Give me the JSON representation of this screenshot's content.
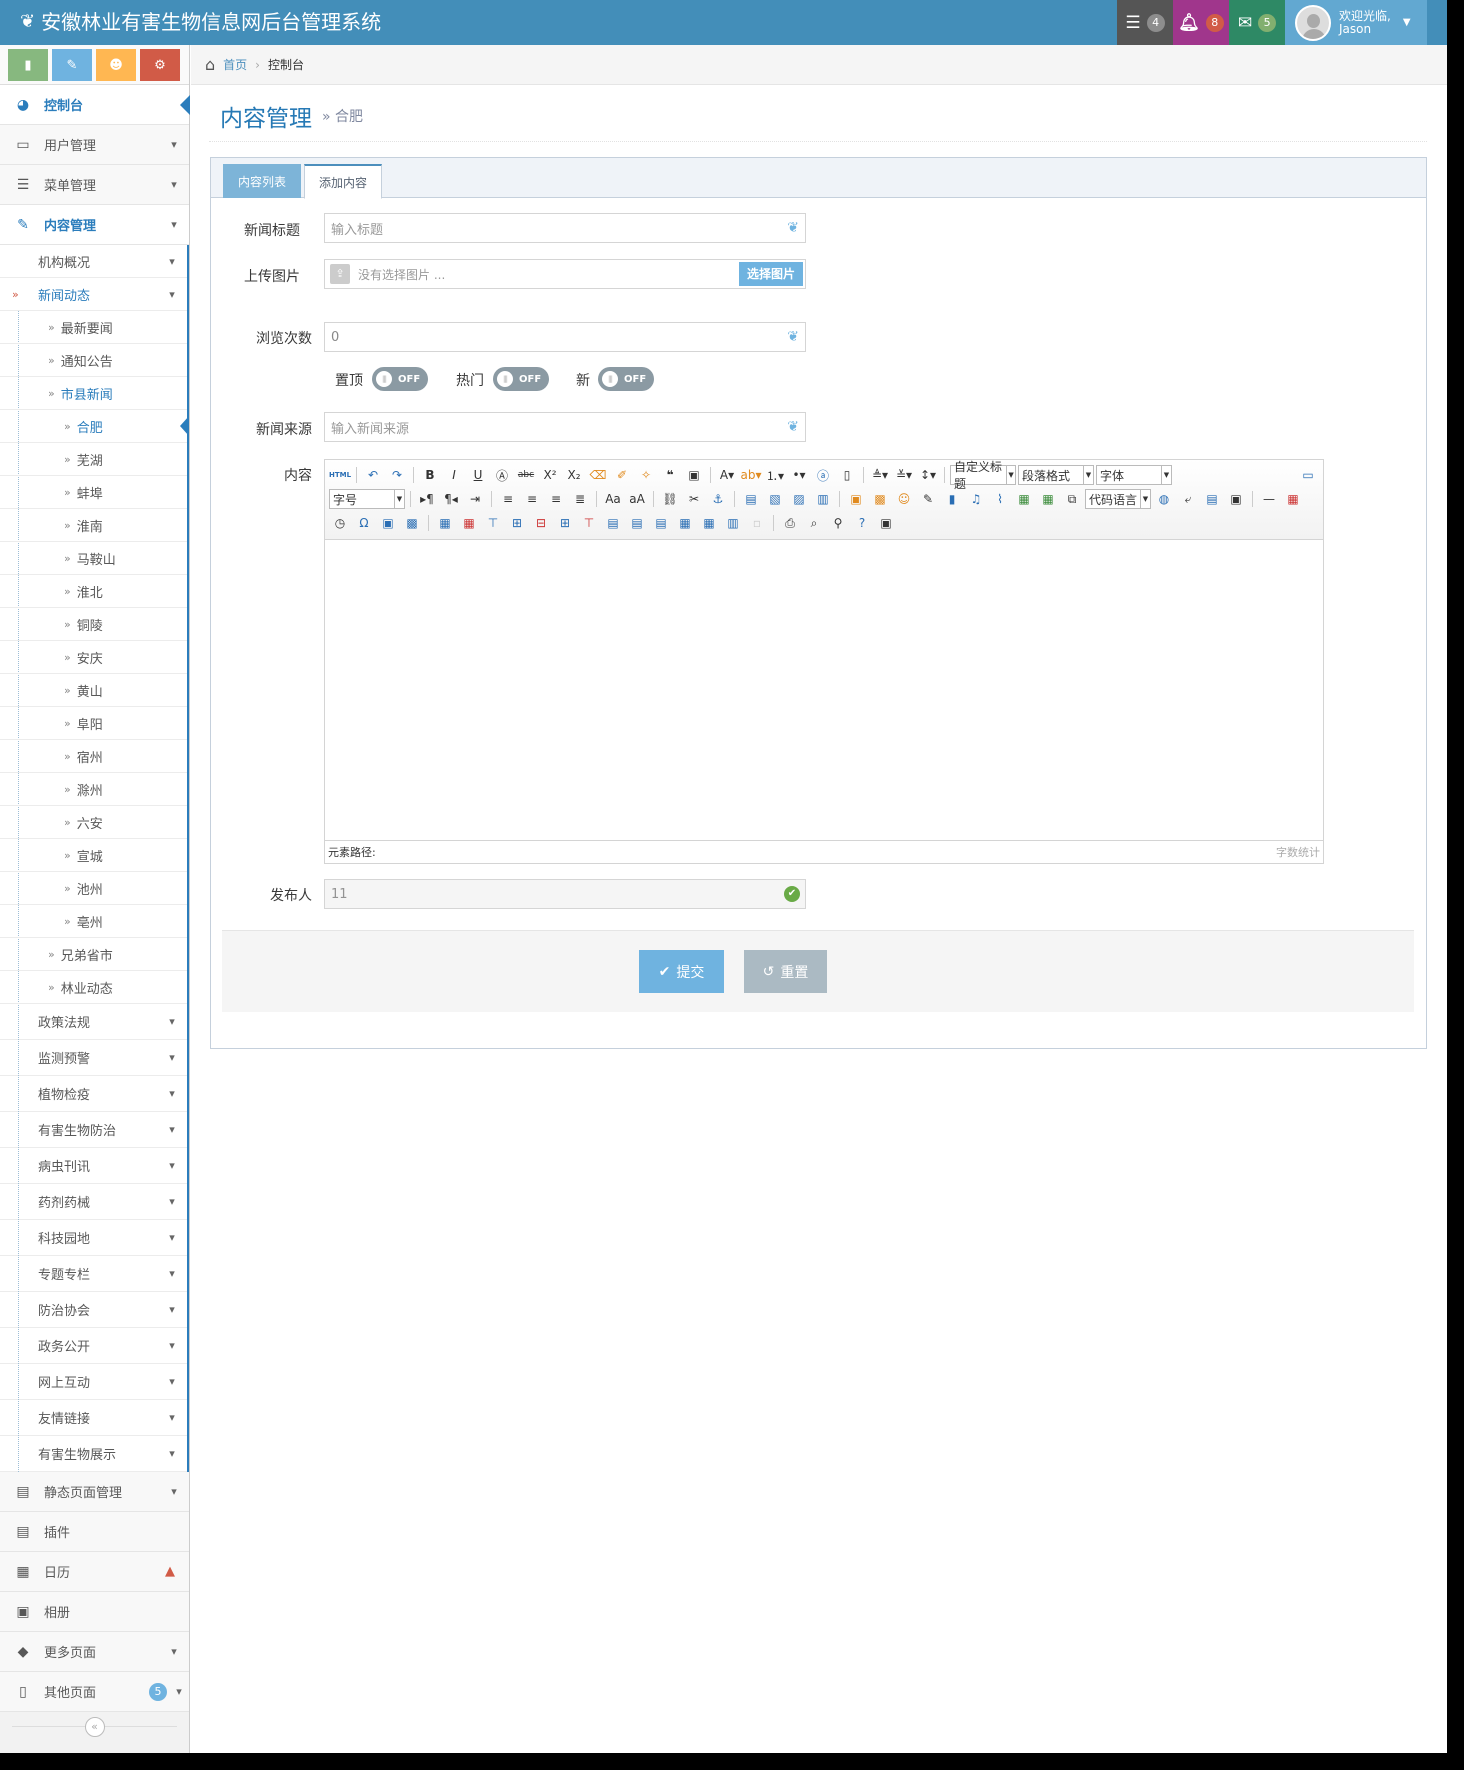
{
  "navbar": {
    "title": "安徽林业有害生物信息网后台管理系统",
    "tasks_count": "4",
    "notifications_count": "8",
    "messages_count": "5",
    "welcome": "欢迎光临,",
    "username": "Jason"
  },
  "sidebar": {
    "items": [
      {
        "label": "控制台"
      },
      {
        "label": "用户管理"
      },
      {
        "label": "菜单管理"
      },
      {
        "label": "内容管理"
      }
    ],
    "content_sub": {
      "org": "机构概况",
      "news": "新闻动态",
      "news_children": {
        "latest": "最新要闻",
        "notice": "通知公告",
        "city": "市县新闻",
        "cities": [
          "合肥",
          "芜湖",
          "蚌埠",
          "淮南",
          "马鞍山",
          "淮北",
          "铜陵",
          "安庆",
          "黄山",
          "阜阳",
          "宿州",
          "滁州",
          "六安",
          "宣城",
          "池州",
          "亳州"
        ],
        "brother": "兄弟省市",
        "forestry": "林业动态"
      },
      "rest": [
        "政策法规",
        "监测预警",
        "植物检疫",
        "有害生物防治",
        "病虫刊讯",
        "药剂药械",
        "科技园地",
        "专题专栏",
        "防治协会",
        "政务公开",
        "网上互动",
        "友情链接",
        "有害生物展示"
      ]
    },
    "bottom": {
      "static_pages": "静态页面管理",
      "plugins": "插件",
      "calendar": "日历",
      "album": "相册",
      "more_pages": "更多页面",
      "other_pages": "其他页面",
      "other_badge": "5"
    }
  },
  "breadcrumb": {
    "home": "首页",
    "current": "控制台"
  },
  "page": {
    "title": "内容管理",
    "subtitle": "» 合肥"
  },
  "tabs": {
    "list": "内容列表",
    "add": "添加内容"
  },
  "form": {
    "title_label": "新闻标题",
    "title_placeholder": "输入标题",
    "image_label": "上传图片",
    "image_empty": "没有选择图片 ...",
    "image_button": "选择图片",
    "views_label": "浏览次数",
    "views_value": "0",
    "top_label": "置顶",
    "hot_label": "热门",
    "new_label": "新",
    "switch_off": "OFF",
    "source_label": "新闻来源",
    "source_placeholder": "输入新闻来源",
    "content_label": "内容",
    "publisher_label": "发布人",
    "publisher_value": "11"
  },
  "editor": {
    "custom_heading": "自定义标题",
    "paragraph": "段落格式",
    "font": "字体",
    "font_size": "字号",
    "code_lang": "代码语言",
    "path_label": "元素路径:",
    "word_count": "字数统计"
  },
  "actions": {
    "submit": "提交",
    "reset": "重置"
  },
  "colors": {
    "navbar": "#438eb9",
    "accent": "#2b7dbc",
    "submit": "#6fb3e0",
    "reset": "#abbac3"
  }
}
